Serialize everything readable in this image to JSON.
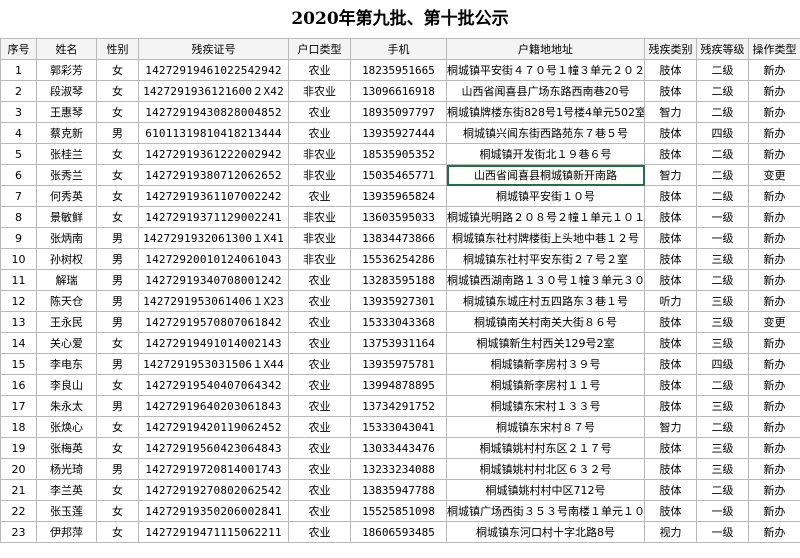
{
  "title": "2020年第九批、第十批公示",
  "headers": [
    "序号",
    "姓名",
    "性别",
    "残疾证号",
    "户口类型",
    "手机",
    "户籍地地址",
    "残疾类别",
    "残疾等级",
    "操作类型"
  ],
  "rows": [
    {
      "no": "1",
      "name": "郭彩芳",
      "gender": "女",
      "id": "14272919461022542942",
      "hukou": "农业",
      "phone": "18235951665",
      "address": "桐城镇平安街４７０号１幢３单元２０２室",
      "category": "肢体",
      "level": "二级",
      "op": "新办"
    },
    {
      "no": "2",
      "name": "段淑琴",
      "gender": "女",
      "id": "1427291936121600２X42",
      "hukou": "非农业",
      "phone": "13096616918",
      "address": "山西省闻喜县广场东路西南巷20号",
      "category": "肢体",
      "level": "二级",
      "op": "新办"
    },
    {
      "no": "3",
      "name": "王惠琴",
      "gender": "女",
      "id": "14272919430828004852",
      "hukou": "农业",
      "phone": "18935097797",
      "address": "桐城镇牌楼东街828号1号楼4单元502室",
      "category": "智力",
      "level": "二级",
      "op": "新办"
    },
    {
      "no": "4",
      "name": "蔡克新",
      "gender": "男",
      "id": "61011319810418213444",
      "hukou": "农业",
      "phone": "13935927444",
      "address": "桐城镇兴闻东街西路苑东７巷５号",
      "category": "肢体",
      "level": "四级",
      "op": "新办"
    },
    {
      "no": "5",
      "name": "张桂兰",
      "gender": "女",
      "id": "14272919361222002942",
      "hukou": "非农业",
      "phone": "18535905352",
      "address": "桐城镇开发街北１９巷６号",
      "category": "肢体",
      "level": "二级",
      "op": "新办"
    },
    {
      "no": "6",
      "name": "张秀兰",
      "gender": "女",
      "id": "14272919380712062652",
      "hukou": "非农业",
      "phone": "15035465771",
      "address": "山西省闻喜县桐城镇新开南路",
      "category": "智力",
      "level": "二级",
      "op": "变更"
    },
    {
      "no": "7",
      "name": "何秀英",
      "gender": "女",
      "id": "14272919361107002242",
      "hukou": "农业",
      "phone": "13935965824",
      "address": "桐城镇平安街１０号",
      "category": "肢体",
      "level": "二级",
      "op": "新办"
    },
    {
      "no": "8",
      "name": "景敏鲜",
      "gender": "女",
      "id": "14272919371129002241",
      "hukou": "非农业",
      "phone": "13603595033",
      "address": "桐城镇光明路２０８号２幢１单元１０１室",
      "category": "肢体",
      "level": "一级",
      "op": "新办"
    },
    {
      "no": "9",
      "name": "张炳南",
      "gender": "男",
      "id": "1427291932061300１X41",
      "hukou": "非农业",
      "phone": "13834473866",
      "address": "桐城镇东社村牌楼街上头地中巷１２号",
      "category": "肢体",
      "level": "一级",
      "op": "新办"
    },
    {
      "no": "10",
      "name": "孙树权",
      "gender": "男",
      "id": "14272920010124061043",
      "hukou": "非农业",
      "phone": "15536254286",
      "address": "桐城镇东社村平安东街２７号２室",
      "category": "肢体",
      "level": "三级",
      "op": "新办"
    },
    {
      "no": "11",
      "name": "解瑞",
      "gender": "男",
      "id": "14272919340708001242",
      "hukou": "农业",
      "phone": "13283595188",
      "address": "桐城镇西湖南路１３０号１幢３单元３０１室",
      "category": "肢体",
      "level": "二级",
      "op": "新办"
    },
    {
      "no": "12",
      "name": "陈天仓",
      "gender": "男",
      "id": "1427291953061406１X23",
      "hukou": "农业",
      "phone": "13935927301",
      "address": "桐城镇东城庄村五四路东３巷１号",
      "category": "听力",
      "level": "三级",
      "op": "新办"
    },
    {
      "no": "13",
      "name": "王永民",
      "gender": "男",
      "id": "14272919570807061842",
      "hukou": "农业",
      "phone": "15333043368",
      "address": "桐城镇南关村南关大街８６号",
      "category": "肢体",
      "level": "三级",
      "op": "变更"
    },
    {
      "no": "14",
      "name": "关心爱",
      "gender": "女",
      "id": "14272919491014002143",
      "hukou": "农业",
      "phone": "13753931164",
      "address": "桐城镇新生村西关129号2室",
      "category": "肢体",
      "level": "三级",
      "op": "新办"
    },
    {
      "no": "15",
      "name": "李电东",
      "gender": "男",
      "id": "1427291953031506１X44",
      "hukou": "农业",
      "phone": "13935975781",
      "address": "桐城镇新李房村３９号",
      "category": "肢体",
      "level": "四级",
      "op": "新办"
    },
    {
      "no": "16",
      "name": "李良山",
      "gender": "女",
      "id": "14272919540407064342",
      "hukou": "农业",
      "phone": "13994878895",
      "address": "桐城镇新李房村１１号",
      "category": "肢体",
      "level": "二级",
      "op": "新办"
    },
    {
      "no": "17",
      "name": "朱永太",
      "gender": "男",
      "id": "14272919640203061843",
      "hukou": "农业",
      "phone": "13734291752",
      "address": "桐城镇东宋村１３３号",
      "category": "肢体",
      "level": "三级",
      "op": "新办"
    },
    {
      "no": "18",
      "name": "张焕心",
      "gender": "女",
      "id": "14272919420119062452",
      "hukou": "农业",
      "phone": "15333043041",
      "address": "桐城镇东宋村８７号",
      "category": "智力",
      "level": "二级",
      "op": "新办"
    },
    {
      "no": "19",
      "name": "张梅英",
      "gender": "女",
      "id": "14272919560423064843",
      "hukou": "农业",
      "phone": "13033443476",
      "address": "桐城镇姚村村东区２１７号",
      "category": "肢体",
      "level": "三级",
      "op": "新办"
    },
    {
      "no": "20",
      "name": "杨光琦",
      "gender": "男",
      "id": "14272919720814001743",
      "hukou": "农业",
      "phone": "13233234088",
      "address": "桐城镇姚村村北区６３２号",
      "category": "肢体",
      "level": "三级",
      "op": "新办"
    },
    {
      "no": "21",
      "name": "李兰英",
      "gender": "女",
      "id": "14272919270802062542",
      "hukou": "农业",
      "phone": "13835947788",
      "address": "桐城镇姚村村中区712号",
      "category": "肢体",
      "level": "二级",
      "op": "新办"
    },
    {
      "no": "22",
      "name": "张玉莲",
      "gender": "女",
      "id": "14272919350206002841",
      "hukou": "农业",
      "phone": "15525851098",
      "address": "桐城镇广场西街３５３号南楼１单元１０１室",
      "category": "肢体",
      "level": "一级",
      "op": "新办"
    },
    {
      "no": "23",
      "name": "伊邦萍",
      "gender": "女",
      "id": "14272919471115062211",
      "hukou": "农业",
      "phone": "18606593485",
      "address": "桐城镇东河口村十字北路8号",
      "category": "视力",
      "level": "一级",
      "op": "新办"
    }
  ]
}
